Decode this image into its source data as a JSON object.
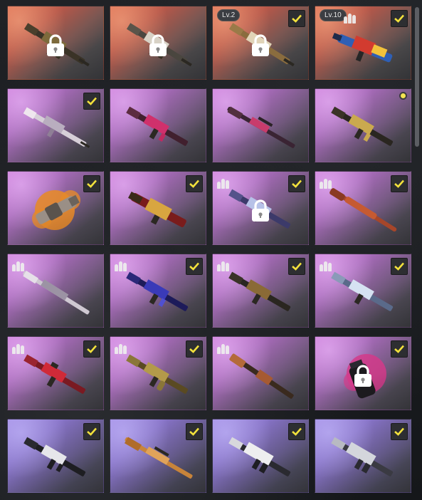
{
  "level_badges": {
    "card3": "Lv.2",
    "card4": "Lv.10"
  },
  "colors": {
    "check": "#f2e13c",
    "orange_rarity": "#c96a52",
    "purple_rarity": "#b06cc2",
    "blue_rarity": "#8f7cd6"
  },
  "cards": [
    {
      "rarity": "orange",
      "state": "locked",
      "icon": "assault-rifle-icon"
    },
    {
      "rarity": "orange",
      "state": "locked",
      "icon": "assault-rifle-icon"
    },
    {
      "rarity": "orange",
      "state": "locked-selected",
      "icon": "assault-rifle-icon"
    },
    {
      "rarity": "orange",
      "state": "selected",
      "icon": "smg-icon"
    },
    {
      "rarity": "purple",
      "state": "selected",
      "icon": "dmr-icon"
    },
    {
      "rarity": "purple",
      "state": "unselected",
      "icon": "assault-rifle-icon"
    },
    {
      "rarity": "purple",
      "state": "unselected",
      "icon": "sniper-rifle-icon"
    },
    {
      "rarity": "purple",
      "state": "new",
      "icon": "assault-rifle-icon"
    },
    {
      "rarity": "purple",
      "state": "selected",
      "icon": "grenade-launcher-icon"
    },
    {
      "rarity": "purple",
      "state": "selected",
      "icon": "shotgun-icon"
    },
    {
      "rarity": "purple",
      "state": "locked-selected",
      "icon": "assault-rifle-icon"
    },
    {
      "rarity": "purple",
      "state": "selected",
      "icon": "bolt-action-rifle-icon"
    },
    {
      "rarity": "purple",
      "state": "unselected",
      "icon": "sniper-rifle-icon"
    },
    {
      "rarity": "purple",
      "state": "selected",
      "icon": "assault-rifle-icon"
    },
    {
      "rarity": "purple",
      "state": "selected",
      "icon": "assault-rifle-icon"
    },
    {
      "rarity": "purple",
      "state": "selected",
      "icon": "assault-rifle-icon"
    },
    {
      "rarity": "purple",
      "state": "selected",
      "icon": "m16-rifle-icon"
    },
    {
      "rarity": "purple",
      "state": "selected",
      "icon": "akm-rifle-icon"
    },
    {
      "rarity": "purple",
      "state": "unselected",
      "icon": "pump-shotgun-icon"
    },
    {
      "rarity": "purple",
      "state": "locked-selected",
      "icon": "grenade-icon"
    },
    {
      "rarity": "blue",
      "state": "selected",
      "icon": "assault-rifle-icon"
    },
    {
      "rarity": "blue",
      "state": "selected",
      "icon": "sniper-rifle-icon"
    },
    {
      "rarity": "blue",
      "state": "selected",
      "icon": "assault-rifle-icon"
    },
    {
      "rarity": "blue",
      "state": "selected",
      "icon": "assault-rifle-icon"
    }
  ]
}
